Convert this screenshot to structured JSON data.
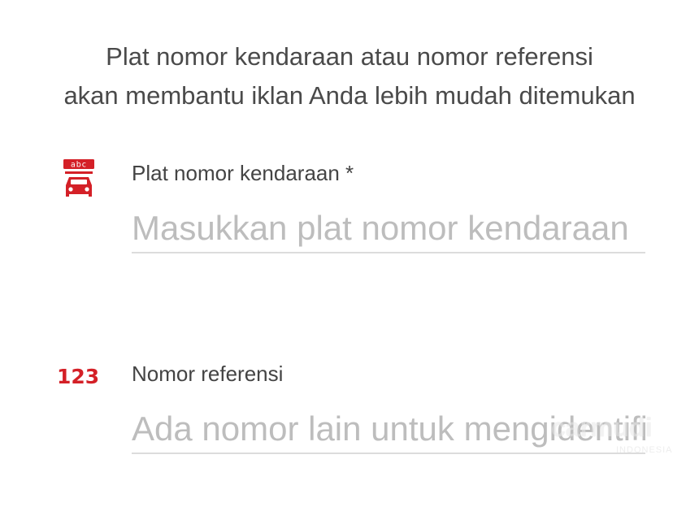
{
  "intro": {
    "line1": "Plat nomor kendaraan atau nomor referensi",
    "line2": "akan membantu iklan Anda lebih mudah ditemukan"
  },
  "plate_field": {
    "icon": "license-plate-car-icon",
    "icon_text": "abc",
    "label": "Plat nomor kendaraan *",
    "placeholder": "Masukkan plat nomor kendaraan",
    "value": ""
  },
  "reference_field": {
    "icon": "number-123-icon",
    "icon_text": "123",
    "label": "Nomor referensi",
    "placeholder": "Ada nomor lain untuk mengidentifikasi",
    "value": ""
  },
  "watermark": {
    "brand": "carmudi",
    "sub": "INDONESIA"
  },
  "colors": {
    "accent": "#d42027",
    "text": "#444444",
    "placeholder": "#bdbdbd",
    "underline": "#dcdcdc"
  }
}
